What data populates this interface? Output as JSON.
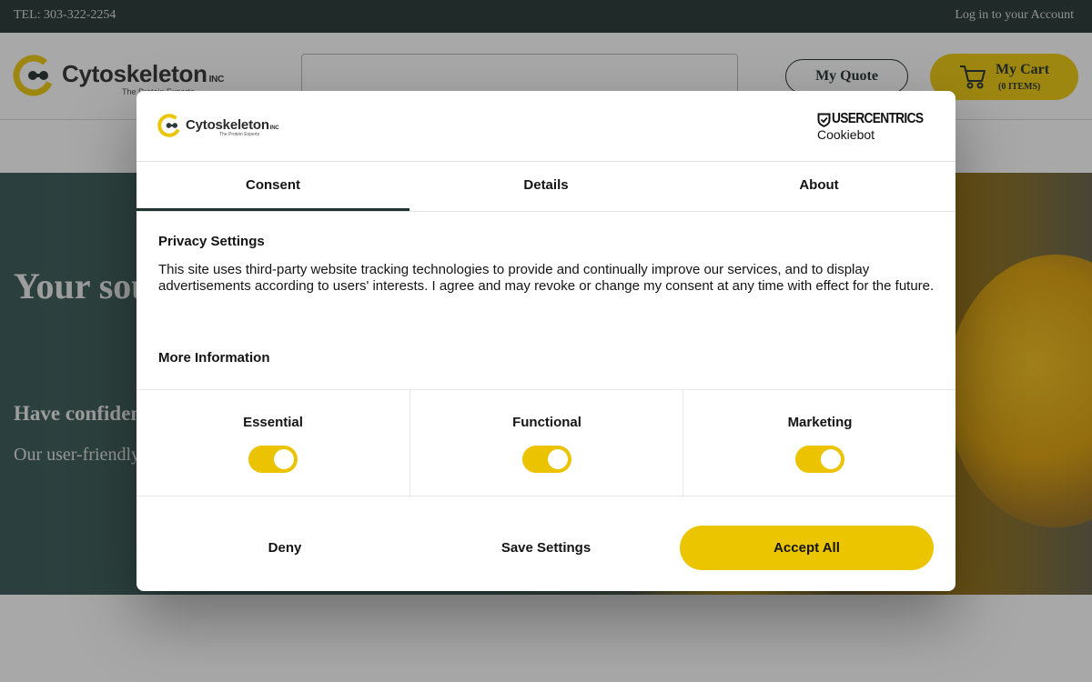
{
  "topbar": {
    "tel": "TEL: 303-322-2254",
    "login": "Log in to your Account"
  },
  "header": {
    "logo_word": "Cytoskeleton",
    "logo_inc": "INC",
    "logo_tag": "The Protein Experts",
    "quote_label": "My Quote",
    "cart_label": "My Cart",
    "cart_count": "(0 ITEMS)"
  },
  "hero": {
    "title": "Your source for cytoskeleton biology",
    "subtitle": "Have confidence in your research",
    "body": "Our user-friendly kits and reagents are designed for reliability and consistency."
  },
  "dialog": {
    "logo_word": "Cytoskeleton",
    "logo_inc": "INC",
    "logo_tag": "The Protein Experts",
    "provider_brand": "USERCENTRICS",
    "provider_sub": "Cookiebot",
    "tabs": [
      {
        "label": "Consent",
        "active": true
      },
      {
        "label": "Details",
        "active": false
      },
      {
        "label": "About",
        "active": false
      }
    ],
    "privacy_title": "Privacy Settings",
    "privacy_text": "This site uses third-party website tracking technologies to provide and continually improve our services, and to display advertisements according to users' interests. I agree and may revoke or change my consent at any time with effect for the future.",
    "more_info": "More Information",
    "toggles": [
      {
        "label": "Essential",
        "on": true
      },
      {
        "label": "Functional",
        "on": true
      },
      {
        "label": "Marketing",
        "on": true
      }
    ],
    "buttons": {
      "deny": "Deny",
      "save": "Save Settings",
      "accept": "Accept All"
    }
  },
  "colors": {
    "brand_yellow": "#ebc500",
    "topbar": "#31403f",
    "tab_underline": "#1f3431"
  }
}
